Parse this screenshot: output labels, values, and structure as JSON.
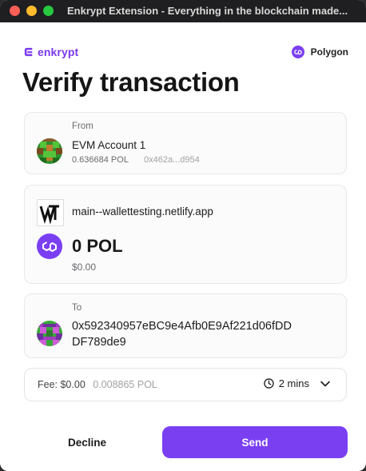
{
  "window": {
    "title": "Enkrypt Extension - Everything in the blockchain made..."
  },
  "header": {
    "brand": "enkrypt",
    "network": "Polygon"
  },
  "page": {
    "title": "Verify transaction"
  },
  "from": {
    "label": "From",
    "account_name": "EVM Account 1",
    "balance": "0.636684 POL",
    "address_short": "0x462a...d954"
  },
  "dapp": {
    "domain": "main--wallettesting.netlify.app",
    "amount": "0 POL",
    "fiat": "$0.00"
  },
  "to": {
    "label": "To",
    "address_line1": "0x592340957eBC9e4Afb0E9Af221d06fDD",
    "address_line2": "DF789de9"
  },
  "fee": {
    "label": "Fee: $0.00",
    "amount": "0.008865 POL",
    "time": "2 mins"
  },
  "actions": {
    "decline": "Decline",
    "send": "Send"
  },
  "colors": {
    "accent": "#7b3ff2",
    "brand": "#7c3aed",
    "traffic_close": "#fe5f57",
    "traffic_min": "#febc2e",
    "traffic_max": "#28c840"
  }
}
